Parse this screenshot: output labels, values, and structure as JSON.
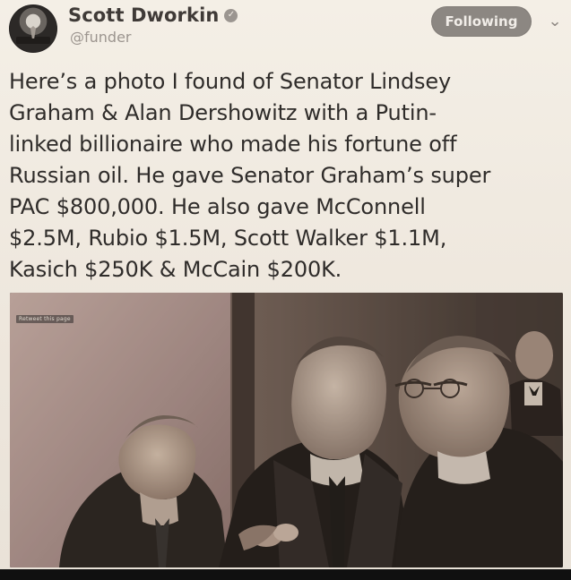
{
  "tweet": {
    "display_name": "Scott Dworkin",
    "handle": "@funder",
    "follow_label": "Following",
    "text": "Here’s a photo I found of Senator Lindsey\nGraham & Alan Dershowitz with a Putin-\nlinked billionaire who made his fortune off\nRussian oil. He gave Senator Graham’s super\nPAC $800,000. He also gave McConnell\n$2.5M, Rubio $1.5M, Scott Walker $1.1M,\nKasich $250K & McCain $200K.",
    "media_caption": "Retweet this page"
  },
  "icons": {
    "verified": "verified-badge-icon",
    "menu": "chevron-down-icon"
  },
  "colors": {
    "name": "#3f3a37",
    "handle": "#9c958f",
    "follow_button": "#8c8782",
    "text": "#2f2c2a"
  }
}
